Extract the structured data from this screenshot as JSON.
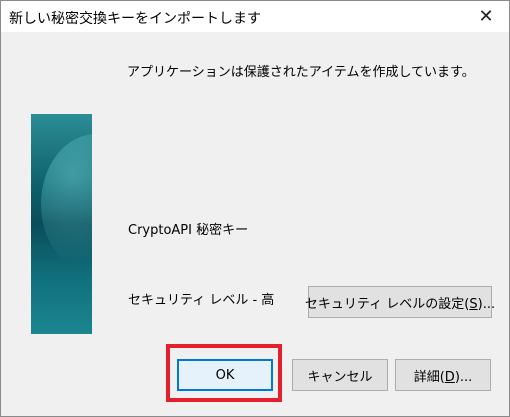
{
  "window": {
    "title": "新しい秘密交換キーをインポートします",
    "close_glyph": "✕"
  },
  "content": {
    "message": "アプリケーションは保護されたアイテムを作成しています。",
    "item_label": "CryptoAPI 秘密キー",
    "security_level": "セキュリティ レベル - 高"
  },
  "buttons": {
    "security_level_prefix": "セキュリティ レベルの設定(",
    "security_level_accel": "S",
    "security_level_suffix": ")...",
    "ok": "OK",
    "cancel": "キャンセル",
    "details_prefix": "詳細(",
    "details_accel": "D",
    "details_suffix": ")..."
  },
  "colors": {
    "accent": "#0078d7",
    "highlight": "#e3202b"
  }
}
